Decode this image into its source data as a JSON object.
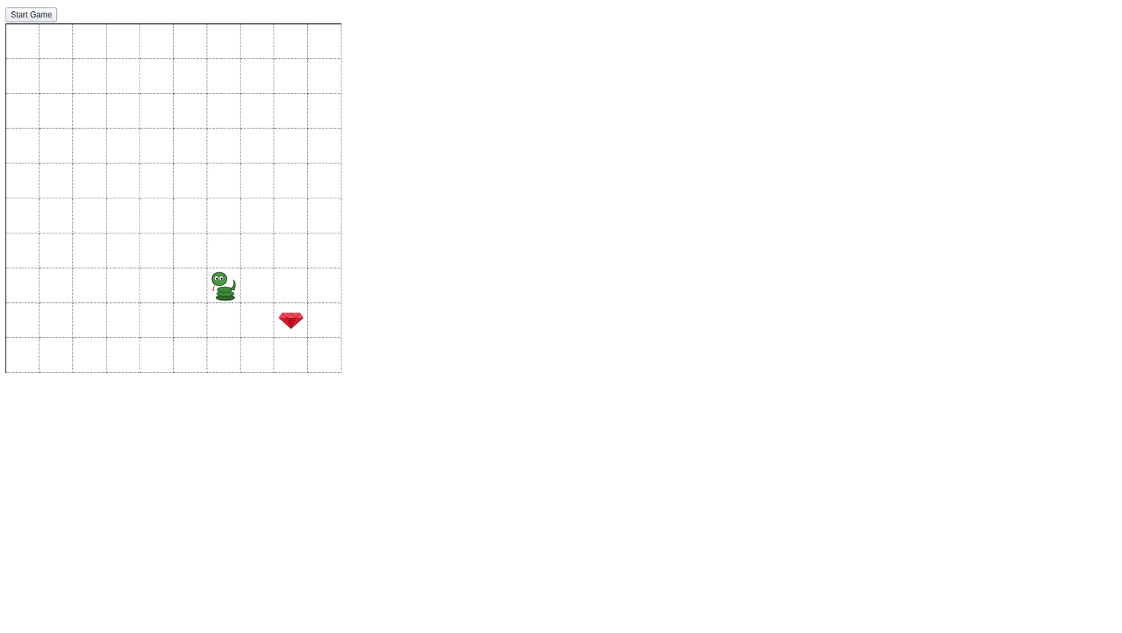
{
  "controls": {
    "start_button": "Start Game"
  },
  "board": {
    "rows": 10,
    "cols": 10
  },
  "pieces": [
    {
      "kind": "snake",
      "row": 7,
      "col": 6
    },
    {
      "kind": "gem",
      "row": 8,
      "col": 8
    }
  ]
}
